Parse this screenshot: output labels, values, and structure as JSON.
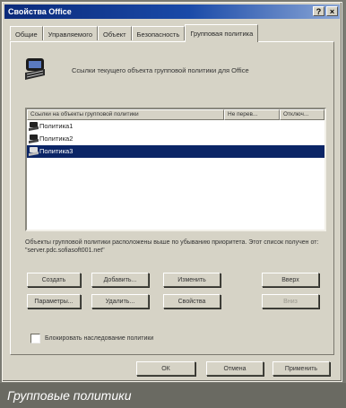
{
  "window": {
    "title": "Свойства Office",
    "controls": [
      "?",
      "×"
    ]
  },
  "tabs": [
    {
      "label": "Общие",
      "active": false
    },
    {
      "label": "Управляемого",
      "active": false
    },
    {
      "label": "Объект",
      "active": false
    },
    {
      "label": "Безопасность",
      "active": false
    },
    {
      "label": "Групповая политика",
      "active": true
    }
  ],
  "header": {
    "text": "Ссылки текущего объекта групповой политики для Office"
  },
  "list": {
    "columns": [
      "Ссылки на объекты групповой политики",
      "Не перев...",
      "Отключ..."
    ],
    "rows": [
      {
        "label": "Политика1",
        "selected": false
      },
      {
        "label": "Политика2",
        "selected": false
      },
      {
        "label": "Политика3",
        "selected": true
      }
    ]
  },
  "info_text": "Объекты групповой политики расположены выше по убыванию приоритета. Этот список получен от: \"server.pdc.sofiasoft001.net\"",
  "buttons": {
    "create": "Создать",
    "add": "Добавить...",
    "edit": "Изменить",
    "up": "Вверх",
    "options": "Параметры...",
    "delete": "Удалить...",
    "properties": "Свойства",
    "down": "Вниз"
  },
  "checkbox": {
    "label": "Блокировать наследование политики",
    "checked": false
  },
  "footer": {
    "ok": "ОК",
    "cancel": "Отмена",
    "apply": "Применить"
  },
  "caption": "Групповые политики"
}
